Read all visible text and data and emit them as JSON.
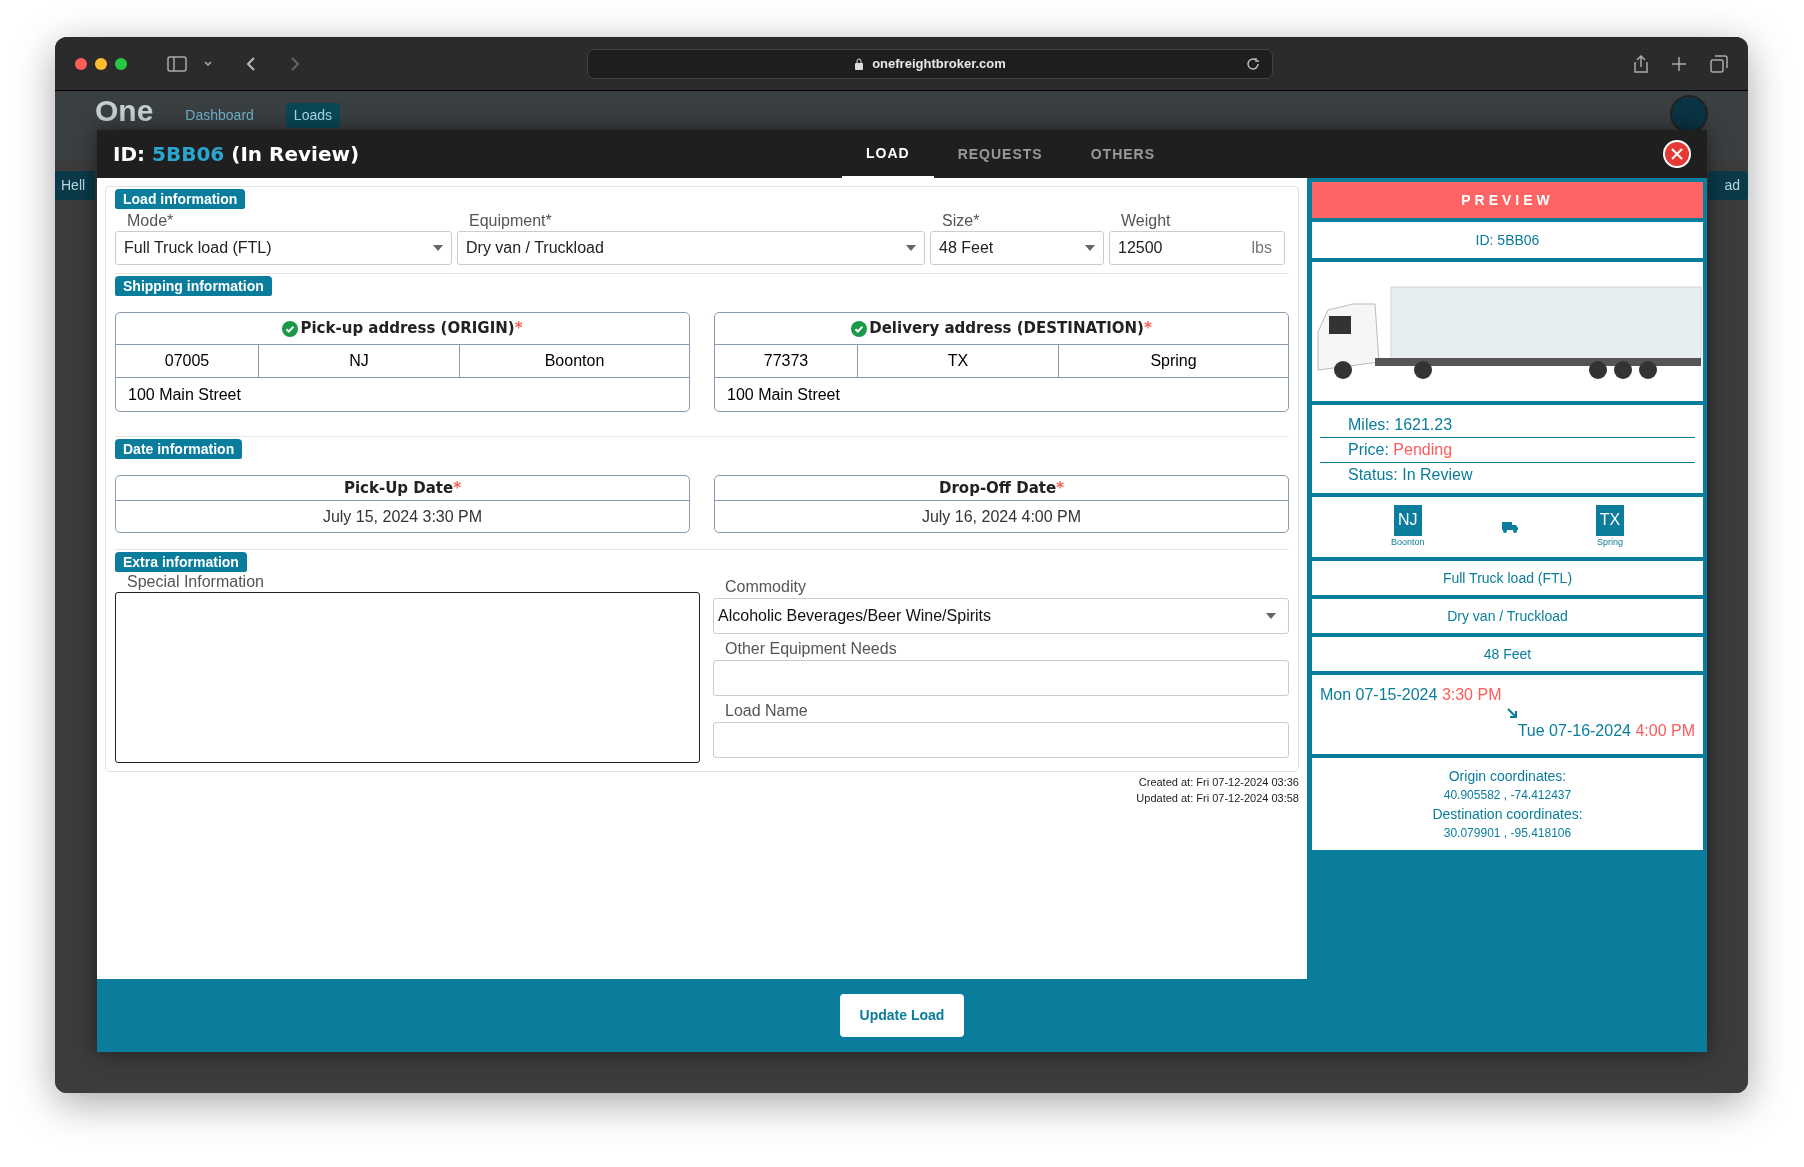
{
  "browser": {
    "url": "onefreightbroker.com"
  },
  "background_app": {
    "logo": "One",
    "nav": [
      {
        "label": "Dashboard",
        "selected": false
      },
      {
        "label": "Loads",
        "selected": true
      }
    ],
    "greeting": "Hell",
    "side_button": "ad"
  },
  "modal": {
    "id_label": "ID: ",
    "load_id": "5BB06",
    "status": "(In Review)",
    "tabs": [
      {
        "label": "LOAD",
        "selected": true
      },
      {
        "label": "REQUESTS",
        "selected": false
      },
      {
        "label": "OTHERS",
        "selected": false
      }
    ],
    "load_information": {
      "heading": "Load information",
      "fields": [
        {
          "kind": "select",
          "label": "Mode*",
          "value": "Full Truck load (FTL)"
        },
        {
          "kind": "select",
          "label": "Equipment*",
          "value": "Dry van / Truckload"
        },
        {
          "kind": "select",
          "label": "Size*",
          "value": "48 Feet"
        },
        {
          "kind": "input",
          "label": "Weight",
          "value": "12500",
          "unit": "lbs"
        }
      ]
    },
    "shipping_information": {
      "heading": "Shipping information",
      "addresses": [
        {
          "title": "Pick-up address (ORIGIN)",
          "verified": true,
          "required_mark": "*",
          "zip": "07005",
          "state": "NJ",
          "city": "Boonton",
          "street": "100 Main Street"
        },
        {
          "title": "Delivery address (DESTINATION)",
          "verified": true,
          "required_mark": "*",
          "zip": "77373",
          "state": "TX",
          "city": "Spring",
          "street": "100 Main Street"
        }
      ]
    },
    "date_information": {
      "heading": "Date information",
      "dates": [
        {
          "title": "Pick-Up Date",
          "required_mark": "*",
          "value": "July 15, 2024 3:30 PM"
        },
        {
          "title": "Drop-Off Date",
          "required_mark": "*",
          "value": "July 16, 2024 4:00 PM"
        }
      ]
    },
    "extra_information": {
      "heading": "Extra information",
      "special_information": {
        "label": "Special Information"
      },
      "commodity": {
        "label": "Commodity",
        "value": "Alcoholic Beverages/Beer Wine/Spirits"
      },
      "other_equipment": {
        "label": "Other Equipment Needs"
      },
      "load_name": {
        "label": "Load Name"
      }
    },
    "timestamps": [
      "Created at: Fri 07-12-2024 03:36",
      "Updated at: Fri 07-12-2024 03:58"
    ],
    "preview": {
      "heading": "PREVIEW",
      "id": "ID: 5BB06",
      "miles": "Miles: 1621.23",
      "price_label": "Price: ",
      "price_value": "Pending",
      "status": "Status: In Review",
      "route": {
        "origin": {
          "state": "NJ",
          "city": "Boonton"
        },
        "destination": {
          "state": "TX",
          "city": "Spring"
        }
      },
      "mode": "Full Truck load (FTL)",
      "equipment": "Dry van / Truckload",
      "size": "48 Feet",
      "schedule": [
        {
          "date": "Mon 07-15-2024",
          "time": "3:30 PM"
        },
        {
          "date": "Tue 07-16-2024",
          "time": "4:00 PM"
        }
      ],
      "coordinates": [
        {
          "label": "Origin coordinates:",
          "value": "40.905582 , -74.412437"
        },
        {
          "label": "Destination coordinates:",
          "value": "30.079901 , -95.418106"
        }
      ]
    },
    "footer_button": "Update Load"
  }
}
